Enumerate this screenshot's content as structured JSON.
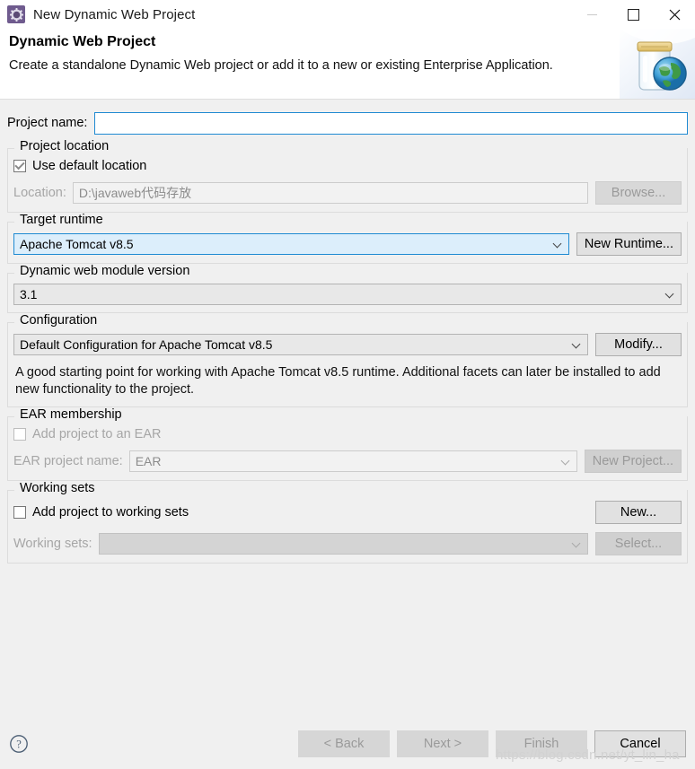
{
  "window": {
    "title": "New Dynamic Web Project",
    "icon": "eclipse-wizard-icon",
    "controls": {
      "minimize": "minimize-icon",
      "maximize": "maximize-icon",
      "close": "close-icon"
    }
  },
  "banner": {
    "title": "Dynamic Web Project",
    "description": "Create a standalone Dynamic Web project or add it to a new or existing Enterprise Application.",
    "art": "jar-with-globe-icon"
  },
  "project_name": {
    "label": "Project name:",
    "value": "",
    "placeholder": ""
  },
  "annotation": {
    "type": "red-underline",
    "color": "#ff0000"
  },
  "project_location": {
    "group_title": "Project location",
    "use_default_label": "Use default location",
    "use_default_checked": true,
    "location_label": "Location:",
    "location_value": "D:\\javaweb代码存放",
    "browse_label": "Browse..."
  },
  "target_runtime": {
    "group_title": "Target runtime",
    "selected": "Apache Tomcat v8.5",
    "new_runtime_label": "New Runtime..."
  },
  "module_version": {
    "group_title": "Dynamic web module version",
    "selected": "3.1"
  },
  "configuration": {
    "group_title": "Configuration",
    "selected": "Default Configuration for Apache Tomcat v8.5",
    "modify_label": "Modify...",
    "description": "A good starting point for working with Apache Tomcat v8.5 runtime. Additional facets can later be installed to add new functionality to the project."
  },
  "ear_membership": {
    "group_title": "EAR membership",
    "add_to_ear_label": "Add project to an EAR",
    "add_to_ear_checked": false,
    "ear_project_label": "EAR project name:",
    "ear_project_value": "EAR",
    "new_project_label": "New Project..."
  },
  "working_sets": {
    "group_title": "Working sets",
    "add_to_working_sets_label": "Add project to working sets",
    "add_to_working_sets_checked": false,
    "new_label": "New...",
    "working_sets_label": "Working sets:",
    "working_sets_value": "",
    "select_label": "Select..."
  },
  "footer": {
    "help_icon": "help-icon",
    "back_label": "< Back",
    "next_label": "Next >",
    "finish_label": "Finish",
    "cancel_label": "Cancel",
    "watermark": "https://blog.csdn.net/yt_lin_ha"
  }
}
